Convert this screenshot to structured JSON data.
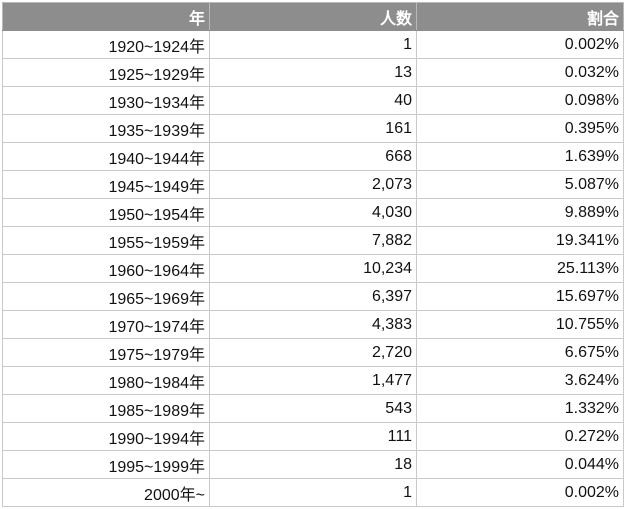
{
  "header": {
    "year": "年",
    "count": "人数",
    "ratio": "割合"
  },
  "rows": [
    {
      "year": "1920~1924年",
      "count": "1",
      "ratio": "0.002%"
    },
    {
      "year": "1925~1929年",
      "count": "13",
      "ratio": "0.032%"
    },
    {
      "year": "1930~1934年",
      "count": "40",
      "ratio": "0.098%"
    },
    {
      "year": "1935~1939年",
      "count": "161",
      "ratio": "0.395%"
    },
    {
      "year": "1940~1944年",
      "count": "668",
      "ratio": "1.639%"
    },
    {
      "year": "1945~1949年",
      "count": "2,073",
      "ratio": "5.087%"
    },
    {
      "year": "1950~1954年",
      "count": "4,030",
      "ratio": "9.889%"
    },
    {
      "year": "1955~1959年",
      "count": "7,882",
      "ratio": "19.341%"
    },
    {
      "year": "1960~1964年",
      "count": "10,234",
      "ratio": "25.113%"
    },
    {
      "year": "1965~1969年",
      "count": "6,397",
      "ratio": "15.697%"
    },
    {
      "year": "1970~1974年",
      "count": "4,383",
      "ratio": "10.755%"
    },
    {
      "year": "1975~1979年",
      "count": "2,720",
      "ratio": "6.675%"
    },
    {
      "year": "1980~1984年",
      "count": "1,477",
      "ratio": "3.624%"
    },
    {
      "year": "1985~1989年",
      "count": "543",
      "ratio": "1.332%"
    },
    {
      "year": "1990~1994年",
      "count": "111",
      "ratio": "0.272%"
    },
    {
      "year": "1995~1999年",
      "count": "18",
      "ratio": "0.044%"
    },
    {
      "year": "2000年~",
      "count": "1",
      "ratio": "0.002%"
    }
  ]
}
